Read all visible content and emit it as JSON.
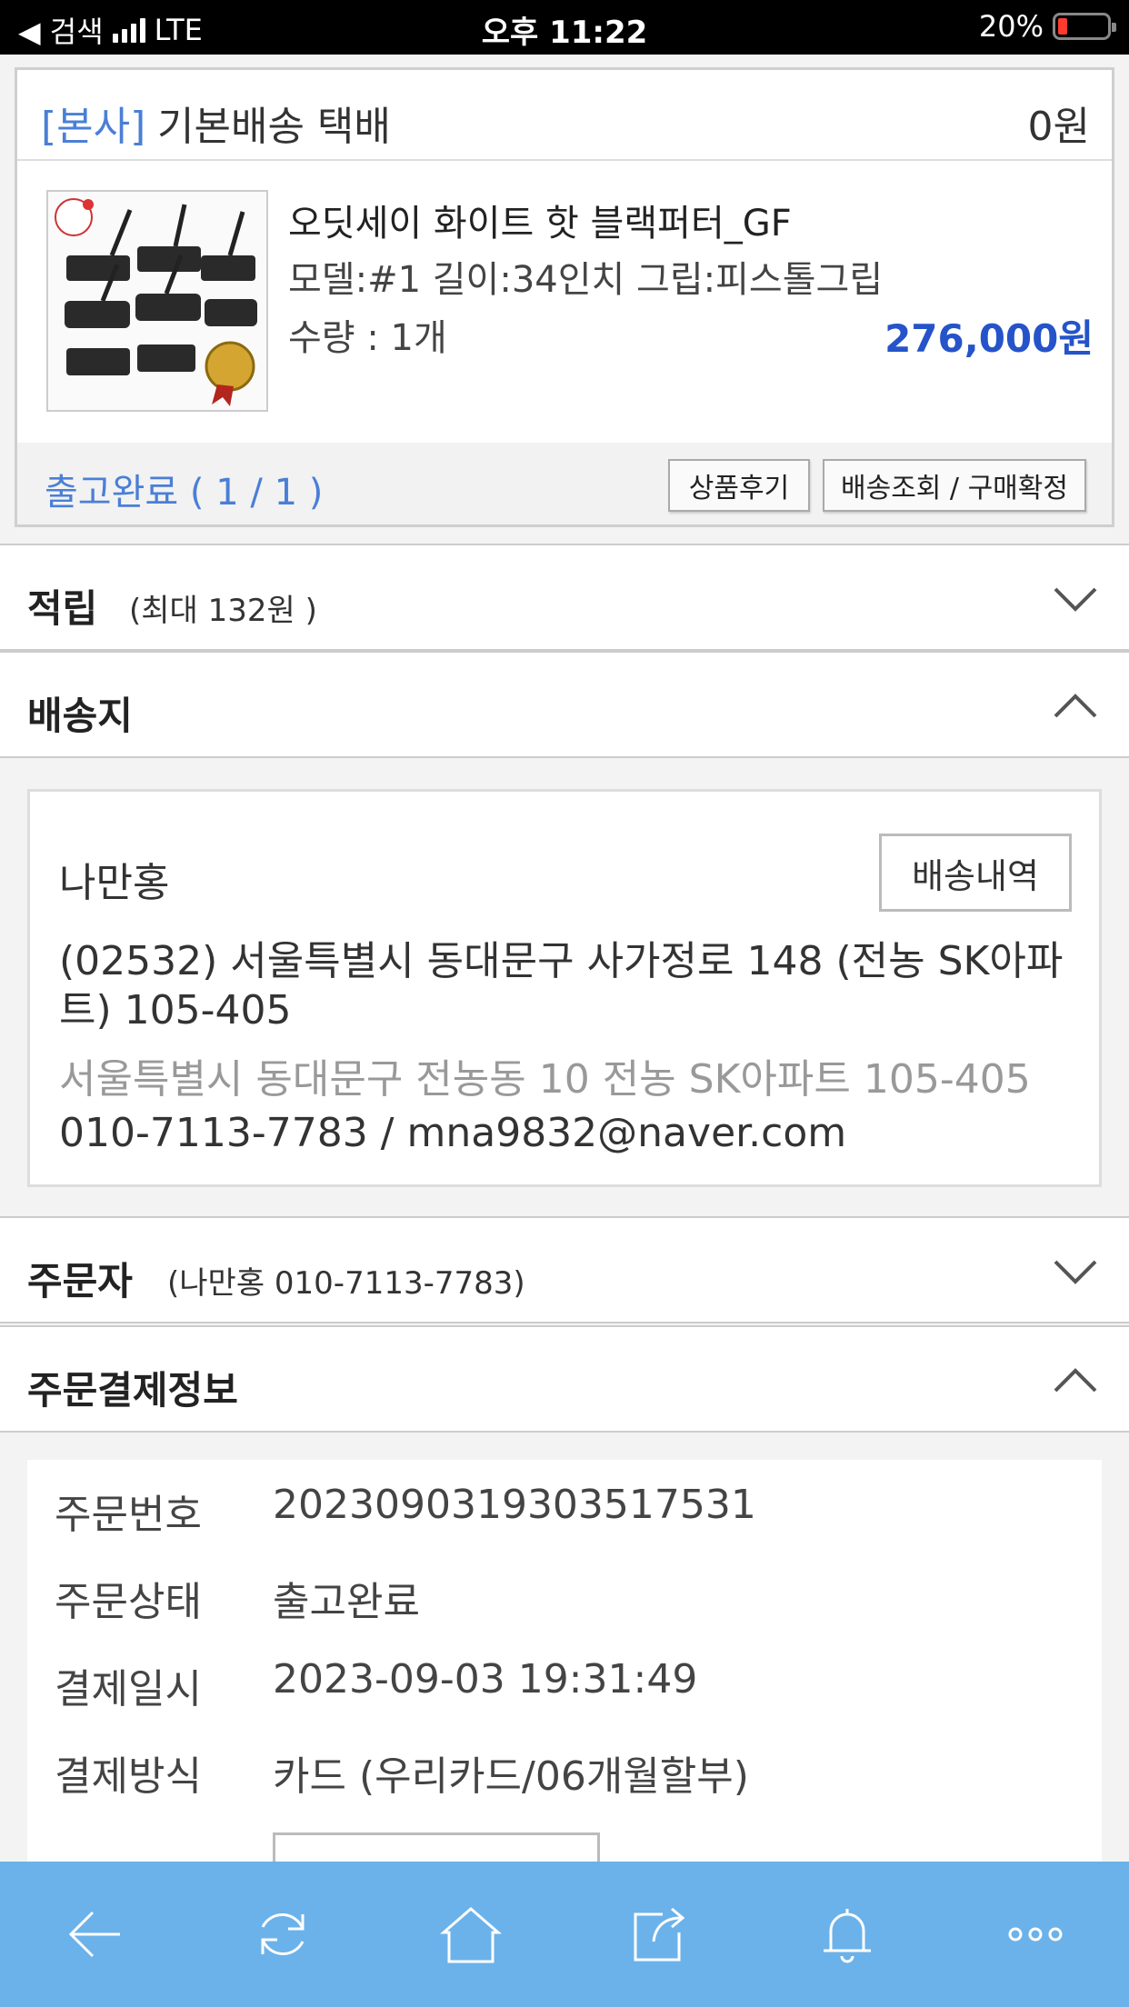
{
  "status_bar": {
    "back_label": "◀ 검색",
    "network": "LTE",
    "time": "오후 11:22",
    "battery": "20%"
  },
  "shipment": {
    "branch": "[본사]",
    "method": "기본배송 택배",
    "fee": "0원",
    "product": {
      "name": "오딧세이 화이트 핫 블랙퍼터_GF",
      "options": "모델:#1 길이:34인치 그립:피스톨그립",
      "quantity": "수량 : 1개",
      "price": "276,000원"
    },
    "status": "출고완료 ( 1 / 1 )",
    "review_button": "상품후기",
    "track_button": "배송조회 / 구매확정"
  },
  "points": {
    "title": "적립",
    "detail": "(최대 132원 )"
  },
  "shipping_address": {
    "title": "배송지",
    "name": "나만홍",
    "history_button": "배송내역",
    "road_address": "(02532) 서울특별시 동대문구 사가정로 148 (전농 SK아파트) 105-405",
    "jibun_address": "서울특별시 동대문구 전농동 10 전농 SK아파트 105-405",
    "contact": "010-7113-7783 / mna9832@naver.com"
  },
  "orderer": {
    "title": "주문자",
    "detail": "(나만홍 010-7113-7783)"
  },
  "payment_info": {
    "title": "주문결제정보",
    "rows": [
      {
        "label": "주문번호",
        "value": "20230903193035175​31"
      },
      {
        "label": "주문상태",
        "value": "출고완료"
      },
      {
        "label": "결제일시",
        "value": "2023-09-03 19:31:49"
      },
      {
        "label": "결제방식",
        "value": "카드 (우리카드/06개월할부)"
      }
    ]
  },
  "colors": {
    "accent_blue": "#4a7fd6",
    "price_blue": "#2553c9",
    "toolbar": "#6bb2ea"
  },
  "toolbar_icons": [
    "back-arrow-icon",
    "refresh-icon",
    "home-icon",
    "share-icon",
    "bell-icon",
    "more-icon"
  ]
}
